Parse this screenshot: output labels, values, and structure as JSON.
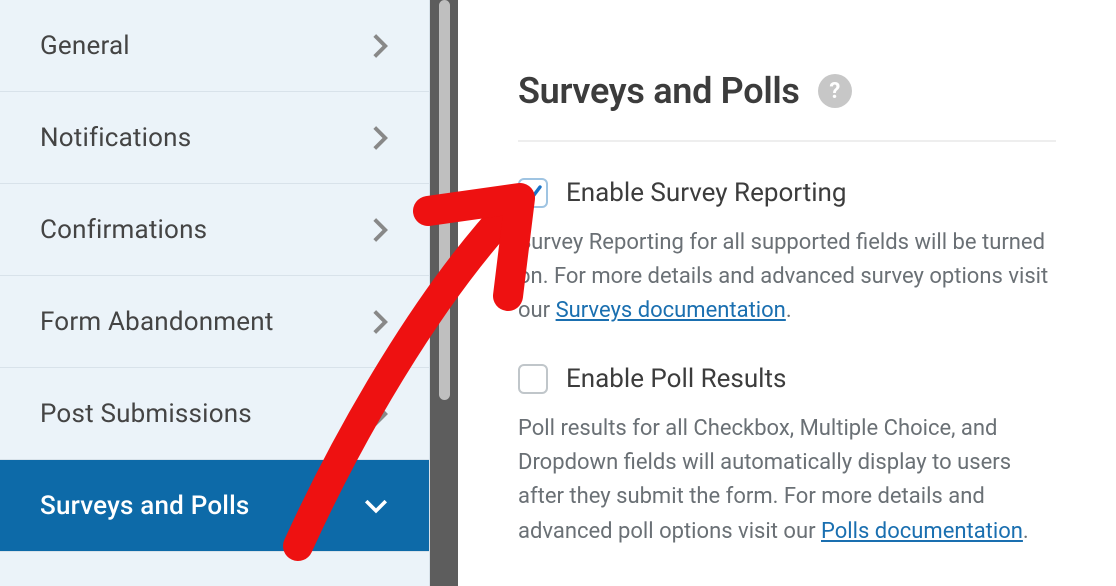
{
  "sidebar": {
    "items": [
      {
        "label": "General"
      },
      {
        "label": "Notifications"
      },
      {
        "label": "Confirmations"
      },
      {
        "label": "Form Abandonment"
      },
      {
        "label": "Post Submissions"
      },
      {
        "label": "Surveys and Polls"
      }
    ]
  },
  "panel": {
    "title": "Surveys and Polls",
    "help_glyph": "?",
    "options": [
      {
        "label": "Enable Survey Reporting",
        "checked": true,
        "desc_pre": "Survey Reporting for all supported fields will be turned on. For more details and advanced survey options visit our ",
        "link_text": "Surveys documentation",
        "desc_post": "."
      },
      {
        "label": "Enable Poll Results",
        "checked": false,
        "desc_pre": "Poll results for all Checkbox, Multiple Choice, and Dropdown fields will automatically display to users after they submit the form. For more details and advanced poll options visit our ",
        "link_text": "Polls documentation",
        "desc_post": "."
      }
    ]
  }
}
